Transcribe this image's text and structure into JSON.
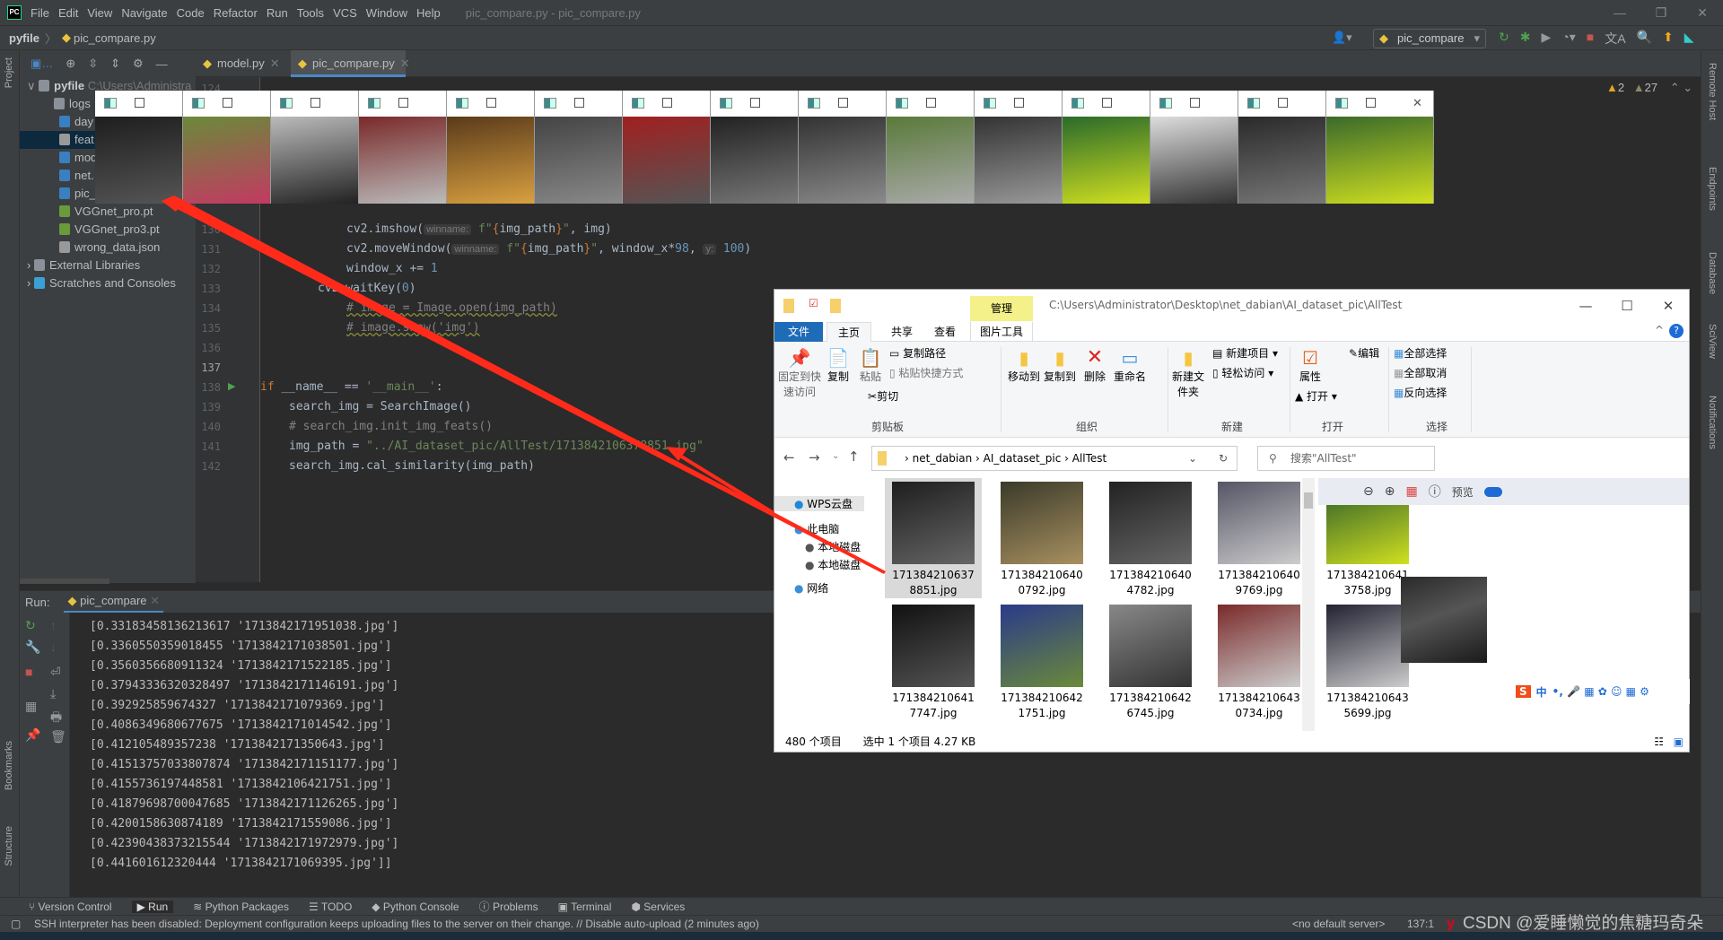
{
  "title_bar": {
    "menu": [
      "File",
      "Edit",
      "View",
      "Navigate",
      "Code",
      "Refactor",
      "Run",
      "Tools",
      "VCS",
      "Window",
      "Help"
    ],
    "window_title": "pic_compare.py - pic_compare.py"
  },
  "nav": {
    "project": "pyfile",
    "file": "pic_compare.py",
    "run_config": "pic_compare"
  },
  "left_strip": {
    "project": "Project",
    "bookmarks": "Bookmarks",
    "structure": "Structure"
  },
  "right_strip": [
    "Remote Host",
    "Endpoints",
    "Database",
    "SciView",
    "Notifications"
  ],
  "project_tree": {
    "root": "pyfile",
    "root_path": "C:\\Users\\Administra",
    "items": [
      {
        "label": "logs",
        "type": "folder"
      },
      {
        "label": "day",
        "type": "python"
      },
      {
        "label": "feat",
        "type": "file",
        "selected": true
      },
      {
        "label": "mod",
        "type": "python"
      },
      {
        "label": "net.",
        "type": "python"
      },
      {
        "label": "pic_",
        "type": "python"
      },
      {
        "label": "VGGnet_pro.pt",
        "type": "pt"
      },
      {
        "label": "VGGnet_pro3.pt",
        "type": "pt"
      },
      {
        "label": "wrong_data.json",
        "type": "json"
      }
    ],
    "external_libraries": "External Libraries",
    "scratches": "Scratches and Consoles"
  },
  "editor": {
    "tabs": [
      {
        "label": "model.py",
        "active": false
      },
      {
        "label": "pic_compare.py",
        "active": true
      }
    ],
    "inspections": {
      "warnings": "2",
      "weak_warnings": "27"
    },
    "top_line": "124",
    "lines": [
      {
        "n": "130",
        "indent": 3,
        "tokens": [
          [
            "cv2.imshow(",
            "code"
          ],
          [
            "winname:",
            "hint"
          ],
          [
            " f\"",
            "str"
          ],
          [
            "{",
            "br"
          ],
          [
            "img_path",
            "code"
          ],
          [
            "}",
            "br"
          ],
          [
            "\"",
            "str"
          ],
          [
            ", img)",
            "code"
          ]
        ]
      },
      {
        "n": "131",
        "indent": 3,
        "tokens": [
          [
            "cv2.moveWindow(",
            "code"
          ],
          [
            "winname:",
            "hint"
          ],
          [
            " f\"",
            "str"
          ],
          [
            "{",
            "br"
          ],
          [
            "img_path",
            "code"
          ],
          [
            "}",
            "br"
          ],
          [
            "\"",
            "str"
          ],
          [
            ", window_x*",
            "code"
          ],
          [
            "98",
            "num"
          ],
          [
            ", ",
            "code"
          ],
          [
            "y:",
            "hint"
          ],
          [
            " ",
            "code"
          ],
          [
            "100",
            "num"
          ],
          [
            ")",
            "code"
          ]
        ]
      },
      {
        "n": "132",
        "indent": 3,
        "tokens": [
          [
            "window_x += ",
            "code"
          ],
          [
            "1",
            "num"
          ]
        ]
      },
      {
        "n": "133",
        "indent": 2,
        "tokens": [
          [
            "cv2.waitKey(",
            "code"
          ],
          [
            "0",
            "num"
          ],
          [
            ")",
            "code"
          ]
        ]
      },
      {
        "n": "134",
        "indent": 3,
        "tokens": [
          [
            "# image = Image.open(img_path)",
            "cmu"
          ]
        ]
      },
      {
        "n": "135",
        "indent": 3,
        "tokens": [
          [
            "# image.show('img')",
            "cmu"
          ]
        ]
      },
      {
        "n": "136",
        "indent": 0,
        "tokens": []
      },
      {
        "n": "137",
        "indent": 0,
        "tokens": []
      },
      {
        "n": "138",
        "indent": 0,
        "tokens": [
          [
            "if ",
            "kw"
          ],
          [
            "__name__ == ",
            "code"
          ],
          [
            "'__main__'",
            "str"
          ],
          [
            ":",
            "code"
          ]
        ]
      },
      {
        "n": "139",
        "indent": 1,
        "tokens": [
          [
            "search_img = SearchImage()",
            "code"
          ]
        ]
      },
      {
        "n": "140",
        "indent": 1,
        "tokens": [
          [
            "# search_img.init_img_feats()",
            "cm"
          ]
        ]
      },
      {
        "n": "141",
        "indent": 1,
        "tokens": [
          [
            "img_path = ",
            "code"
          ],
          [
            "\"../AI_dataset_pic/AllTest/1713842106378851.jpg\"",
            "str"
          ]
        ]
      },
      {
        "n": "142",
        "indent": 1,
        "tokens": [
          [
            "search_img.cal_similarity(img_path)",
            "code"
          ]
        ]
      }
    ]
  },
  "run": {
    "label": "Run:",
    "tab": "pic_compare",
    "output": [
      "[0.33183458136213617 '1713842171951038.jpg']",
      "[0.3360550359018455 '1713842171038501.jpg']",
      "[0.3560356680911324 '1713842171522185.jpg']",
      "[0.37943336320328497 '1713842171146191.jpg']",
      "[0.392925859674327 '1713842171079369.jpg']",
      "[0.4086349680677675 '1713842171014542.jpg']",
      "[0.412105489357238 '1713842171350643.jpg']",
      "[0.41513757033807874 '1713842171151177.jpg']",
      "[0.4155736197448581 '1713842106421751.jpg']",
      "[0.41879698700047685 '1713842171126265.jpg']",
      "[0.4200158630874189 '1713842171559086.jpg']",
      "[0.42390438373215544 '1713842171972979.jpg']",
      "[0.441601612320444 '1713842171069395.jpg']]"
    ]
  },
  "bottom_tools": [
    "Version Control",
    "Run",
    "Python Packages",
    "TODO",
    "Python Console",
    "Problems",
    "Terminal",
    "Services"
  ],
  "status": {
    "message": "SSH interpreter has been disabled: Deployment configuration keeps uploading files to the server on their change. // Disable auto-upload (2 minutes ago)",
    "server": "<no default server>",
    "position": "137:1"
  },
  "watermark": "CSDN @爱睡懒觉的焦糖玛奇朵",
  "cv_windows_count": 15,
  "explorer": {
    "manage_tab": "管理",
    "path": "C:\\Users\\Administrator\\Desktop\\net_dabian\\AI_dataset_pic\\AllTest",
    "tabs": [
      "文件",
      "主页",
      "共享",
      "查看",
      "图片工具"
    ],
    "ribbon": {
      "pin": "固定到快速访问",
      "copy": "复制",
      "paste": "粘贴",
      "copy_path": "复制路径",
      "paste_shortcut": "粘贴快捷方式",
      "cut": "剪切",
      "clipboard": "剪贴板",
      "move_to": "移动到",
      "copy_to": "复制到",
      "delete": "删除",
      "rename": "重命名",
      "organize": "组织",
      "new_folder": "新建文件夹",
      "new_item": "新建项目",
      "easy_access": "轻松访问",
      "new": "新建",
      "properties": "属性",
      "open": "打开",
      "edit": "编辑",
      "open_group": "打开",
      "select_all": "全部选择",
      "select_none": "全部取消",
      "invert": "反向选择",
      "select": "选择"
    },
    "breadcrumb": [
      "net_dabian",
      "AI_dataset_pic",
      "AllTest"
    ],
    "search_placeholder": "搜索\"AllTest\"",
    "nav_pane": [
      "WPS云盘",
      "此电脑",
      "本地磁盘",
      "本地磁盘",
      "网络"
    ],
    "files": [
      {
        "name": "1713842106378851.jpg",
        "selected": true
      },
      {
        "name": "1713842106400792.jpg"
      },
      {
        "name": "1713842106404782.jpg"
      },
      {
        "name": "1713842106409769.jpg"
      },
      {
        "name": "1713842106413758.jpg"
      },
      {
        "name": "1713842106417747.jpg"
      },
      {
        "name": "1713842106421751.jpg"
      },
      {
        "name": "1713842106426745.jpg"
      },
      {
        "name": "1713842106430734.jpg"
      },
      {
        "name": "1713842106435699.jpg"
      }
    ],
    "preview_label": "预览",
    "status_count": "480 个项目",
    "status_selected": "选中 1 个项目  4.27 KB"
  },
  "ime": {
    "mode": "中"
  },
  "colors": {
    "ide_bg": "#2b2b2b",
    "panel": "#3c3f41",
    "keyword": "#cc7832",
    "string": "#6a8759",
    "number": "#6897bb",
    "arrow": "#ff2a1a",
    "explorer_file_tab": "#1e6bb8"
  }
}
